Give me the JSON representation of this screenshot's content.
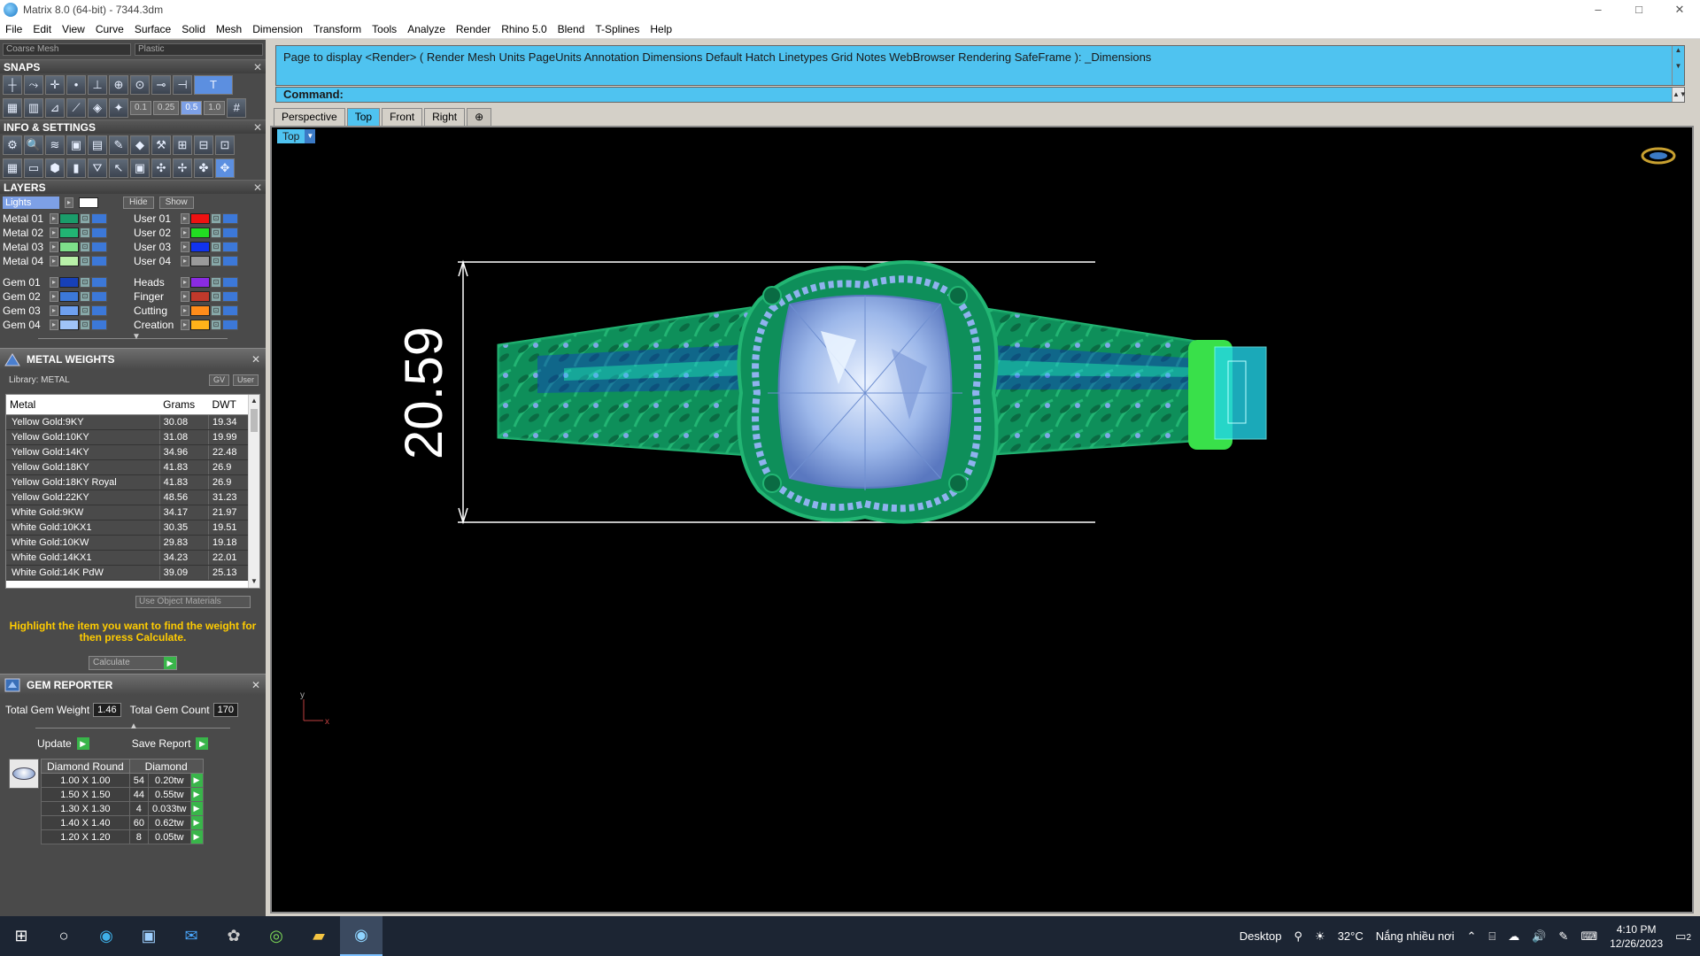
{
  "window": {
    "title": "Matrix 8.0 (64-bit) - 7344.3dm",
    "controls": [
      "–",
      "□",
      "✕"
    ]
  },
  "menu": [
    "File",
    "Edit",
    "View",
    "Curve",
    "Surface",
    "Solid",
    "Mesh",
    "Dimension",
    "Transform",
    "Tools",
    "Analyze",
    "Render",
    "Rhino 5.0",
    "Blend",
    "T-Splines",
    "Help"
  ],
  "panel": {
    "mesh_combo": "Coarse Mesh",
    "material_combo": "Plastic",
    "snaps_title": "SNAPS",
    "snap_values": [
      "0.1",
      "0.25",
      "0.5",
      "1.0"
    ],
    "info_title": "INFO & SETTINGS",
    "layers_title": "LAYERS",
    "lights_label": "Lights",
    "hide_label": "Hide",
    "show_label": "Show",
    "layers_left": [
      {
        "name": "Metal 01",
        "color": "#1a9c6a"
      },
      {
        "name": "Metal 02",
        "color": "#22b573"
      },
      {
        "name": "Metal 03",
        "color": "#7ee08a"
      },
      {
        "name": "Metal 04",
        "color": "#b8f0a8"
      },
      {
        "name": "Gem 01",
        "color": "#1740b8"
      },
      {
        "name": "Gem 02",
        "color": "#3c78d8"
      },
      {
        "name": "Gem 03",
        "color": "#6ea0f0"
      },
      {
        "name": "Gem 04",
        "color": "#9fc3f7"
      }
    ],
    "layers_right": [
      {
        "name": "User 01",
        "color": "#ee1111"
      },
      {
        "name": "User 02",
        "color": "#22dd22"
      },
      {
        "name": "User 03",
        "color": "#1133ee"
      },
      {
        "name": "User 04",
        "color": "#9a9a9a"
      },
      {
        "name": "Heads",
        "color": "#8a2be2"
      },
      {
        "name": "Finger",
        "color": "#c0392b"
      },
      {
        "name": "Cutting",
        "color": "#ff8c1a"
      },
      {
        "name": "Creation",
        "color": "#ffb31a"
      }
    ]
  },
  "metal_weights": {
    "title": "METAL WEIGHTS",
    "library_label": "Library: METAL",
    "gv_label": "GV",
    "user_label": "User",
    "headers": [
      "Metal",
      "Grams",
      "DWT"
    ],
    "rows": [
      [
        "Yellow Gold:9KY",
        "30.08",
        "19.34"
      ],
      [
        "Yellow Gold:10KY",
        "31.08",
        "19.99"
      ],
      [
        "Yellow Gold:14KY",
        "34.96",
        "22.48"
      ],
      [
        "Yellow Gold:18KY",
        "41.83",
        "26.9"
      ],
      [
        "Yellow Gold:18KY Royal",
        "41.83",
        "26.9"
      ],
      [
        "Yellow Gold:22KY",
        "48.56",
        "31.23"
      ],
      [
        "White Gold:9KW",
        "34.17",
        "21.97"
      ],
      [
        "White Gold:10KX1",
        "30.35",
        "19.51"
      ],
      [
        "White Gold:10KW",
        "29.83",
        "19.18"
      ],
      [
        "White Gold:14KX1",
        "34.23",
        "22.01"
      ],
      [
        "White Gold:14K PdW",
        "39.09",
        "25.13"
      ]
    ],
    "use_object_label": "Use Object Materials",
    "hint": "Highlight the item you want to find the weight for then press Calculate.",
    "calculate_label": "Calculate"
  },
  "gem_reporter": {
    "title": "GEM REPORTER",
    "total_weight_label": "Total Gem Weight",
    "total_weight_value": "1.46",
    "total_count_label": "Total Gem Count",
    "total_count_value": "170",
    "update_label": "Update",
    "save_label": "Save Report",
    "headers": [
      "Diamond Round",
      "Diamond"
    ],
    "rows": [
      [
        "1.00 X 1.00",
        "54",
        "0.20tw"
      ],
      [
        "1.50 X 1.50",
        "44",
        "0.55tw"
      ],
      [
        "1.30 X 1.30",
        "4",
        "0.033tw"
      ],
      [
        "1.40 X 1.40",
        "60",
        "0.62tw"
      ],
      [
        "1.20 X 1.20",
        "8",
        "0.05tw"
      ]
    ]
  },
  "command": {
    "history": "Page to display <Render> ( Render  Mesh  Units  PageUnits  Annotation  Dimensions  Default  Hatch  Linetypes  Grid  Notes  WebBrowser  Rendering  SafeFrame ): _Dimensions",
    "prompt_label": "Command:"
  },
  "viewport": {
    "tabs": [
      "Perspective",
      "Top",
      "Front",
      "Right"
    ],
    "active_tab": "Top",
    "label": "Top",
    "dimension_value": "20.59",
    "axis_y": "y",
    "axis_x": "x",
    "colors": {
      "metal": "#0e8f5a",
      "metal_light": "#22b573",
      "gem": "#9db8ea",
      "channel": "#22d4e8",
      "shank_inner": "#1328d8",
      "clasp": "#39e04a"
    }
  },
  "taskbar": {
    "desktop_label": "Desktop",
    "temperature": "32°C",
    "weather": "Nắng nhiều nơi",
    "time": "4:10 PM",
    "date": "12/26/2023",
    "notifications": "2"
  }
}
